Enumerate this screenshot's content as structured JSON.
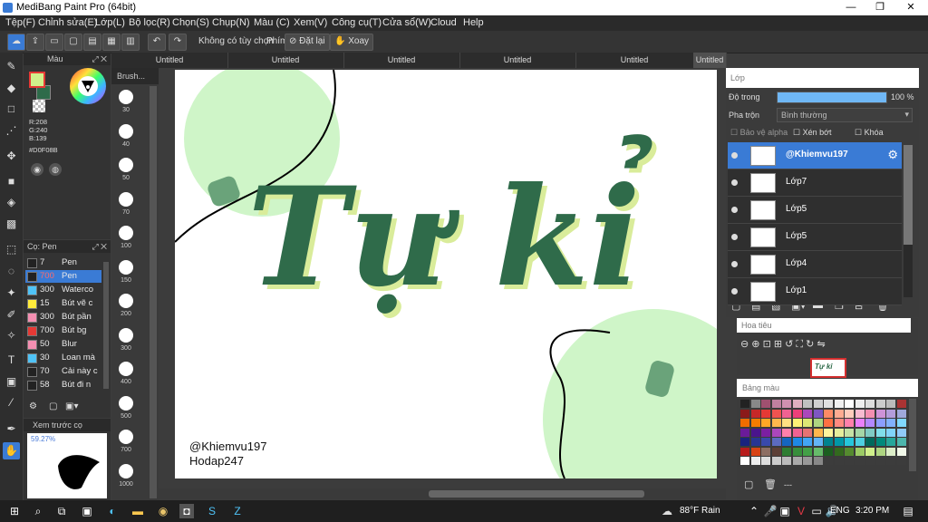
{
  "window": {
    "title": "MediBang Paint Pro (64bit)",
    "minimize": "—",
    "restore": "❐",
    "close": "✕"
  },
  "menu": [
    "Tệp(F)",
    "Chỉnh sửa(E)",
    "Lớp(L)",
    "Bộ lọc(R)",
    "Chọn(S)",
    "Chụp(N)",
    "Màu (C)",
    "Xem(V)",
    "Công cụ(T)",
    "Cửa sổ(W)",
    "Cloud",
    "Help"
  ],
  "toolbar": {
    "selection_label": "Không có tùy chọn",
    "key_label": "Phím",
    "reset_label": "Đặt lại",
    "rotate_label": "Xoay"
  },
  "color_panel": {
    "title": "Màu",
    "r": "R:208",
    "g": "G:240",
    "b": "B:139",
    "hex": "#D0F08B",
    "primary_color": "#D0F08B",
    "secondary_color": "#2E6B4A"
  },
  "brush_panel": {
    "title": "Cọ: Pen",
    "items": [
      {
        "size": "7",
        "name": "Pen",
        "color": "#222222"
      },
      {
        "size": "700",
        "name": "Pen",
        "color": "#222222"
      },
      {
        "size": "300",
        "name": "Waterco",
        "color": "#4fc3f7"
      },
      {
        "size": "15",
        "name": "Bút vẽ c",
        "color": "#ffeb3b"
      },
      {
        "size": "300",
        "name": "Bút pần",
        "color": "#f48fb1"
      },
      {
        "size": "700",
        "name": "Bút bg",
        "color": "#e53935"
      },
      {
        "size": "50",
        "name": "Blur",
        "color": "#f48fb1"
      },
      {
        "size": "30",
        "name": "Loan mà",
        "color": "#4fc3f7"
      },
      {
        "size": "70",
        "name": "Cải này c",
        "color": "#222222"
      },
      {
        "size": "58",
        "name": "Bút đi n",
        "color": "#222222"
      }
    ]
  },
  "preview_panel": {
    "title": "Xem trước cọ",
    "zoom": "59.27%"
  },
  "size_panel": {
    "title": "Brush...",
    "sizes": [
      "30",
      "40",
      "50",
      "70",
      "100",
      "150",
      "200",
      "300",
      "400",
      "500",
      "700",
      "1000"
    ]
  },
  "tabs": [
    "Untitled",
    "Untitled",
    "Untitled",
    "Untitled",
    "Untitled",
    "Untitled"
  ],
  "canvas": {
    "main_text": "Tự kỉ",
    "credit_line1": "@Khiemvu197",
    "credit_line2": "Hodap247"
  },
  "layer_panel": {
    "title": "Lớp",
    "opacity_label": "Độ trong",
    "opacity_value": "100 %",
    "opacity_percent": 100,
    "blend_label": "Pha trộn",
    "blend_value": "Bình thường",
    "protect_alpha": "Bảo vệ alpha",
    "clip": "Xén bớt",
    "lock": "Khóa",
    "layers": [
      "@Khiemvu197",
      "Lớp7",
      "Lớp5",
      "Lớp5",
      "Lớp4",
      "Lớp1"
    ]
  },
  "navigator": {
    "title": "Hoa tiêu"
  },
  "palette": {
    "title": "Bảng màu",
    "footer": "---"
  },
  "taskbar": {
    "weather": "88°F  Rain",
    "lang": "ENG",
    "time": "3:20 PM"
  }
}
